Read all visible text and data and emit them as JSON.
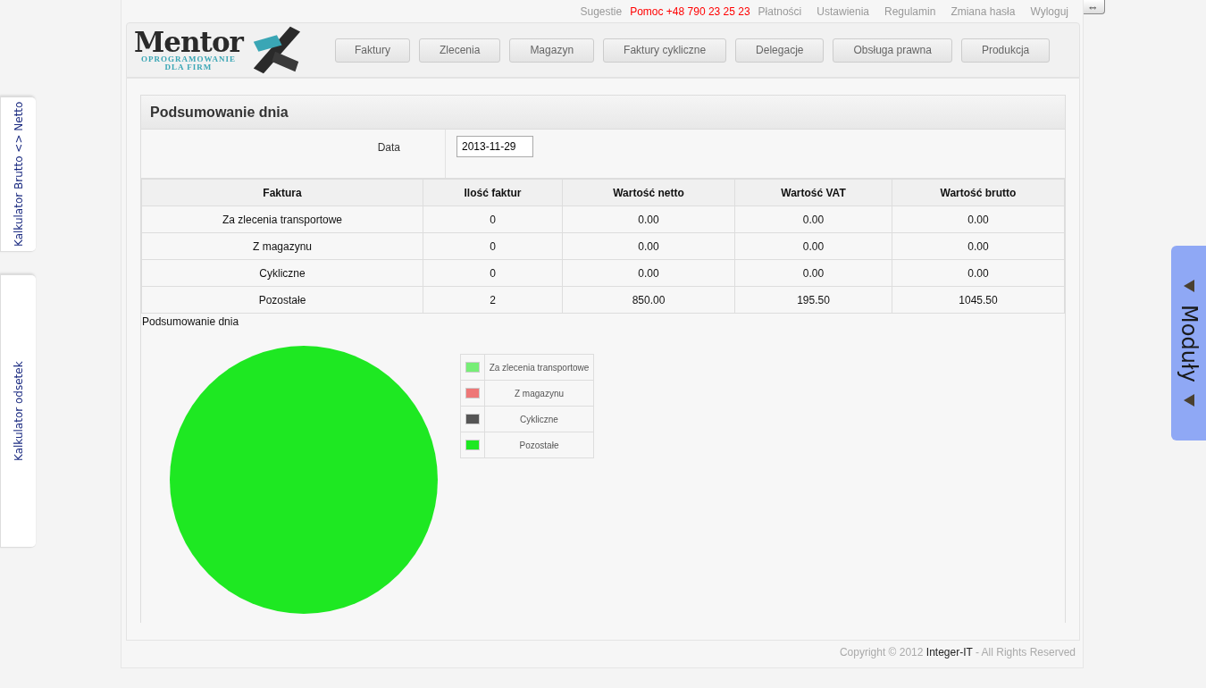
{
  "side_tabs": [
    {
      "label": "Kalkulator Brutto <> Netto"
    },
    {
      "label": "Kalkulator odsetek"
    }
  ],
  "top_links": [
    {
      "label": "Sugestie",
      "kind": "plain"
    },
    {
      "label": "Pomoc +48 790 23 25 23",
      "kind": "alert"
    },
    {
      "label": "Płatności",
      "kind": "plain"
    },
    {
      "label": "Ustawienia",
      "kind": "plain"
    },
    {
      "label": "Regulamin",
      "kind": "plain"
    },
    {
      "label": "Zmiana hasła",
      "kind": "plain"
    },
    {
      "label": "Wyloguj",
      "kind": "plain"
    }
  ],
  "resize_toggle": "⇔",
  "logo": {
    "name": "Mentor",
    "tagline": [
      "OPROGRAMOWANIE",
      "DLA FIRM"
    ]
  },
  "nav": [
    "Faktury",
    "Zlecenia",
    "Magazyn",
    "Faktury cykliczne",
    "Delegacje",
    "Obsługa prawna",
    "Produkcja"
  ],
  "panel": {
    "title": "Podsumowanie dnia",
    "date_label": "Data",
    "date_value": "2013-11-29"
  },
  "table": {
    "columns": [
      "Faktura",
      "Ilość faktur",
      "Wartość netto",
      "Wartość VAT",
      "Wartość brutto"
    ],
    "rows": [
      [
        "Za zlecenia transportowe",
        "0",
        "0.00",
        "0.00",
        "0.00"
      ],
      [
        "Z magazynu",
        "0",
        "0.00",
        "0.00",
        "0.00"
      ],
      [
        "Cykliczne",
        "0",
        "0.00",
        "0.00",
        "0.00"
      ],
      [
        "Pozostałe",
        "2",
        "850.00",
        "195.50",
        "1045.50"
      ]
    ]
  },
  "chart_data": {
    "type": "pie",
    "title": "Podsumowanie dnia",
    "categories": [
      "Za zlecenia transportowe",
      "Z magazynu",
      "Cykliczne",
      "Pozostałe"
    ],
    "series": [
      {
        "colors": [
          "#77ee77",
          "#ee7777",
          "#555555",
          "#1ee822"
        ],
        "values": [
          0,
          0,
          0,
          100
        ]
      }
    ]
  },
  "modules_tab": {
    "label": "Moduły"
  },
  "footer": {
    "prefix": "Copyright © 2012",
    "company": "Integer-IT",
    "suffix": "- All Rights Reserved"
  }
}
